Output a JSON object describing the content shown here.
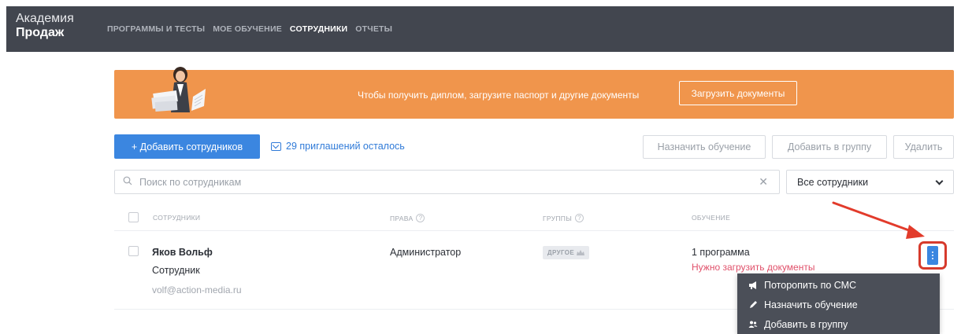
{
  "app": {
    "logo_line1": "Академия",
    "logo_line2": "Продаж"
  },
  "nav": [
    {
      "label": "ПРОГРАММЫ И ТЕСТЫ",
      "active": false
    },
    {
      "label": "МОЕ ОБУЧЕНИЕ",
      "active": false
    },
    {
      "label": "СОТРУДНИКИ",
      "active": true
    },
    {
      "label": "ОТЧЕТЫ",
      "active": false
    }
  ],
  "banner": {
    "text": "Чтобы получить диплом, загрузите паспорт и другие документы",
    "button": "Загрузить документы",
    "color": "#f0954c"
  },
  "actions": {
    "add_employees": "+ Добавить сотрудников",
    "invites": "29 приглашений осталось",
    "assign_training": "Назначить обучение",
    "add_to_group": "Добавить в группу",
    "delete": "Удалить"
  },
  "search": {
    "placeholder": "Поиск по сотрудникам",
    "value": "",
    "clear_icon": "close-icon"
  },
  "filter": {
    "selected": "Все сотрудники"
  },
  "table": {
    "headers": {
      "employees": "СОТРУДНИКИ",
      "rights": "ПРАВА",
      "groups": "ГРУППЫ",
      "training": "ОБУЧЕНИЕ"
    },
    "rows": [
      {
        "name": "Яков Вольф",
        "role": "Сотрудник",
        "email": "volf@action-media.ru",
        "rights": "Администратор",
        "group": "ДРУГОЕ",
        "training": "1 программа",
        "warning": "Нужно загрузить документы"
      }
    ]
  },
  "row_menu": {
    "items": [
      {
        "label": "Поторопить по СМС",
        "icon": "megaphone-icon"
      },
      {
        "label": "Назначить обучение",
        "icon": "pencil-icon"
      },
      {
        "label": "Добавить в группу",
        "icon": "users-icon"
      }
    ]
  },
  "colors": {
    "topbar": "#42464f",
    "primary": "#3b86e0",
    "warning_text": "#e0506a",
    "highlight": "#d63a2c"
  }
}
